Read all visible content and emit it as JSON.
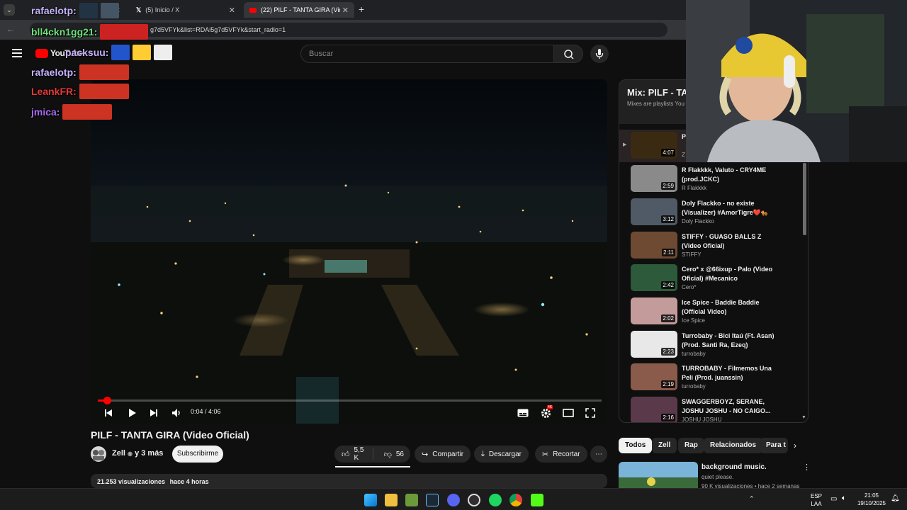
{
  "browser": {
    "tabs": [
      {
        "label": ""
      },
      {
        "label": "(5) Inicio / X"
      },
      {
        "label": "(22) PILF - TANTA GIRA (Video"
      }
    ],
    "url": "g7d5VFYk&list=RDAi5g7d5VFYk&start_radio=1",
    "new_tab": "+"
  },
  "youtube": {
    "logo": "YouTube",
    "search_placeholder": "Buscar",
    "video": {
      "current_time": "0:04 / 4:06",
      "progress_fraction": 0.018,
      "quality_badge": "4K"
    },
    "title": "PILF - TANTA GIRA (Video Oficial)",
    "channel": "Zell",
    "channel_more": "y 3 más",
    "subscribe_label": "Subscribirme",
    "likes": "5,5 K",
    "dislikes": "56",
    "share_label": "Compartir",
    "download_label": "Descargar",
    "clip_label": "Recortar",
    "more_label": "⋯",
    "description": {
      "views": "21.253 visualizaciones",
      "age": "hace 4 horas"
    }
  },
  "playlist": {
    "title": "Mix: PILF - TA",
    "subtitle": "Mixes are playlists You",
    "items": [
      {
        "title": "P C",
        "channel": "Z",
        "duration": "4:07",
        "active": true,
        "color": "#3b2a12"
      },
      {
        "title": "R Flakkkk, Valuto - CRY4ME (prod.JCKC)",
        "channel": "R Flakkkk",
        "duration": "2:59",
        "color": "#8a8a8a"
      },
      {
        "title": "Doly Flackko - no existe (Visualizer) #AmorTigre❤️🐅",
        "channel": "Doly Flackko",
        "duration": "3:12",
        "color": "#505a66"
      },
      {
        "title": "STIFFY - GUASO BALLS Z (Video Oficial)",
        "channel": "STIFFY",
        "duration": "2:11",
        "color": "#6e4a33"
      },
      {
        "title": "Cero* x @66ixup - Palo (Video Oficial) #Mecanico",
        "channel": "Cero*",
        "duration": "2:42",
        "color": "#2d5a3a"
      },
      {
        "title": "Ice Spice - Baddie Baddie (Official Video)",
        "channel": "Ice Spice",
        "duration": "2:02",
        "color": "#c49b9b"
      },
      {
        "title": "Turrobaby - Bici Itaú (Ft. Asan) (Prod. Santi Ra, Ezeq)",
        "channel": "turrobaby",
        "duration": "2:23",
        "color": "#e8e8e8"
      },
      {
        "title": "TURROBABY - Filmemos Una Peli (Prod. juanssin)",
        "channel": "turrobaby",
        "duration": "2:19",
        "color": "#8a5a4a"
      },
      {
        "title": "SWAGGERBOYZ, SERANE, JOSHU JOSHU - NO CAIGO...",
        "channel": "JOSHU JOSHU",
        "duration": "2:16",
        "color": "#5a3a4a"
      }
    ]
  },
  "chips": [
    "Todos",
    "Zell",
    "Rap",
    "Relacionados",
    "Para t"
  ],
  "recommended": {
    "title": "background music.",
    "channel": "quiet please.",
    "meta": "90 K visualizaciones • hace 2 semanas"
  },
  "chat": [
    {
      "user": "rafaelotp:",
      "color": "#c7b3ff"
    },
    {
      "user": "bll4ckn1gg21:",
      "color": "#6fe07a"
    },
    {
      "user": "packsuu:",
      "color": "#c8b2ff"
    },
    {
      "user": "rafaelotp:",
      "color": "#c7b3ff"
    },
    {
      "user": "LeankFR:",
      "color": "#e33838"
    },
    {
      "user": "jmica:",
      "color": "#a86cf0"
    }
  ],
  "taskbar": {
    "lang_top": "ESP",
    "lang_bottom": "LAA",
    "time": "21:05",
    "date": "19/10/2025"
  },
  "colors": {
    "accent_red": "#ff0000",
    "background": "#0f0f0f",
    "surface": "#272727"
  }
}
